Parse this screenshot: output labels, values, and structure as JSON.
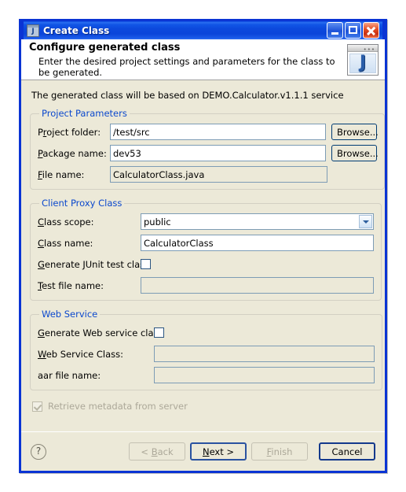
{
  "window": {
    "title": "Create Class",
    "icon": "java-window-icon",
    "minimize_label": "Minimize",
    "maximize_label": "Maximize",
    "close_label": "Close"
  },
  "banner": {
    "title": "Configure generated class",
    "subtitle": "Enter the desired project settings and parameters for the class to be generated.",
    "icon": "java-class-banner-icon"
  },
  "intro": "The generated class will be based on DEMO.Calculator.v1.1.1 service",
  "groups": {
    "project": {
      "legend": "Project Parameters",
      "project_folder": {
        "label_pre": "P",
        "label_mnemonic": "r",
        "label_post": "oject folder:",
        "label_full": "Project folder:",
        "value": "/test/src",
        "browse": "Browse..."
      },
      "package_name": {
        "label_mnemonic": "P",
        "label_post": "ackage name:",
        "label_full": "Package name:",
        "value": "dev53",
        "browse": "Browse..."
      },
      "file_name": {
        "label_mnemonic": "F",
        "label_post": "ile name:",
        "label_full": "File name:",
        "value": "CalculatorClass.java"
      }
    },
    "proxy": {
      "legend": "Client Proxy Class",
      "class_scope": {
        "label_mnemonic": "C",
        "label_post": "lass scope:",
        "label_full": "Class scope:",
        "value": "public",
        "options": [
          "public"
        ]
      },
      "class_name": {
        "label_mnemonic": "C",
        "label_post": "lass name:",
        "label_full": "Class name:",
        "value": "CalculatorClass"
      },
      "generate_junit": {
        "label_mnemonic": "G",
        "label_post": "enerate JUnit test class",
        "label_full": "Generate JUnit test class",
        "checked": false
      },
      "test_file_name": {
        "label_mnemonic": "T",
        "label_post": "est file name:",
        "label_full": "Test file name:",
        "value": ""
      }
    },
    "webservice": {
      "legend": "Web Service",
      "generate_ws": {
        "label_mnemonic": "G",
        "label_post": "enerate Web service class",
        "label_full": "Generate Web service class",
        "checked": false
      },
      "ws_class": {
        "label_mnemonic": "W",
        "label_post": "eb Service Class:",
        "label_full": "Web Service Class:",
        "value": ""
      },
      "aar_file": {
        "label_full": "aar file name:",
        "value": ""
      }
    }
  },
  "retrieve_metadata": {
    "label": "Retrieve metadata from server",
    "checked": true,
    "disabled": true
  },
  "footer": {
    "help": "?",
    "back": "< Back",
    "back_mnemonic": "B",
    "next": "Next >",
    "next_mnemonic": "N",
    "finish": "Finish",
    "finish_mnemonic": "F",
    "cancel": "Cancel"
  },
  "colors": {
    "titlebar_blue": "#0c49dd",
    "dialog_face": "#ece9d8",
    "group_legend": "#0b48cd",
    "field_border": "#7d9cb5",
    "disabled_text": "#aca899"
  }
}
